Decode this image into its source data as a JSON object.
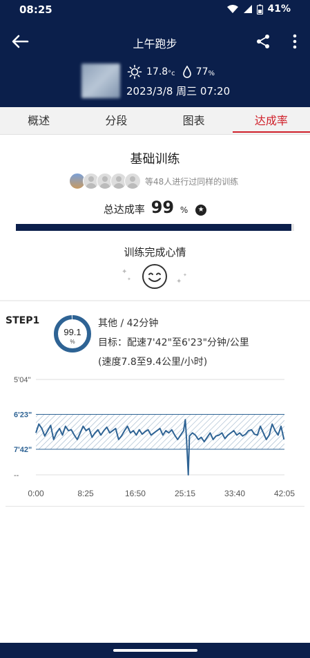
{
  "status_bar": {
    "time": "08:25",
    "battery": "41%"
  },
  "header": {
    "title": "上午跑步",
    "temperature": "17.8",
    "temperature_unit": "°c",
    "humidity": "77",
    "humidity_unit": "%",
    "datetime": "2023/3/8 周三 07:20"
  },
  "tabs": [
    {
      "label": "概述"
    },
    {
      "label": "分段"
    },
    {
      "label": "图表"
    },
    {
      "label": "达成率",
      "active": true
    }
  ],
  "summary": {
    "training_title": "基础训练",
    "participants_text": "等48人进行过同样的训练",
    "rate_label": "总达成率",
    "rate_value": "99",
    "rate_unit": "%",
    "rate_fraction": 0.99,
    "mood_title": "训练完成心情"
  },
  "step": {
    "label": "STEP1",
    "ring_value": "99.1",
    "ring_unit": "%",
    "ring_fraction": 0.991,
    "line1": "其他 / 42分钟",
    "line2": "目标：配速7'42\"至6'23\"分钟/公里",
    "line3": "(速度7.8至9.4公里/小时)"
  },
  "chart_data": {
    "type": "line",
    "x_tick_labels": [
      "0:00",
      "8:25",
      "16:50",
      "25:15",
      "33:40",
      "42:05"
    ],
    "y_tick_labels": [
      "5'04\"",
      "6'23\"",
      "7'42\"",
      "--"
    ],
    "target_band": [
      "6'23\"",
      "7'42\""
    ],
    "x_unit": "minutes",
    "y_unit": "seconds per km",
    "xlim": [
      0,
      42.08
    ],
    "ylim": [
      304,
      520
    ],
    "series": [
      {
        "x": [
          0,
          0.5,
          1,
          1.5,
          2,
          2.5,
          3,
          3.5,
          4,
          4.5,
          5,
          5.5,
          6,
          6.5,
          7,
          7.5,
          8,
          8.5,
          9,
          9.5,
          10,
          10.5,
          11,
          11.5,
          12,
          12.5,
          13,
          13.5,
          14,
          14.5,
          15,
          15.5,
          16,
          16.5,
          17,
          17.5,
          18,
          18.5,
          19,
          19.5,
          20,
          20.5,
          21,
          21.5,
          22,
          22.5,
          23,
          23.5,
          24,
          24.5,
          25,
          25.3,
          25.5,
          25.8,
          26,
          26.5,
          27,
          27.5,
          28,
          28.5,
          29,
          29.5,
          30,
          30.5,
          31,
          31.5,
          32,
          32.5,
          33,
          33.5,
          34,
          34.5,
          35,
          35.5,
          36,
          36.5,
          37,
          37.5,
          38,
          38.5,
          39,
          39.5,
          40,
          40.5,
          41,
          41.5,
          42
        ],
        "y": [
          425,
          405,
          415,
          432,
          420,
          408,
          440,
          425,
          415,
          430,
          410,
          420,
          418,
          430,
          440,
          425,
          410,
          420,
          415,
          435,
          425,
          418,
          430,
          420,
          412,
          425,
          420,
          415,
          440,
          432,
          420,
          410,
          425,
          420,
          430,
          418,
          428,
          422,
          418,
          430,
          425,
          420,
          415,
          430,
          420,
          425,
          418,
          430,
          440,
          430,
          420,
          395,
          440,
          520,
          432,
          425,
          430,
          440,
          435,
          445,
          435,
          425,
          440,
          432,
          430,
          425,
          438,
          430,
          425,
          420,
          430,
          425,
          432,
          428,
          420,
          418,
          428,
          430,
          410,
          425,
          440,
          430,
          405,
          420,
          430,
          410,
          440
        ]
      }
    ]
  }
}
